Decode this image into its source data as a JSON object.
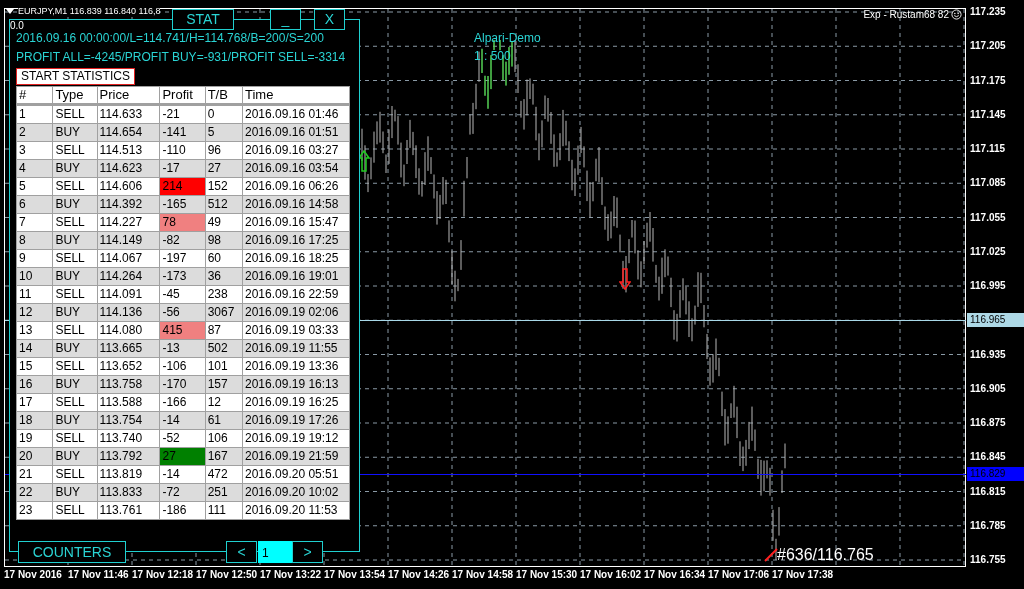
{
  "chart": {
    "header": "EURJPY,M1  116.839 116.840 116,8",
    "broker": "Alpari-Demo",
    "leverage": "1 : 500",
    "expert": "Exp - Rustam68 82",
    "trade_label": "#636/116.765",
    "bid_line": "116.965",
    "ask_line": "116.829",
    "price_labels": [
      "117.235",
      "117.205",
      "117.175",
      "117.145",
      "117.115",
      "117.085",
      "117.055",
      "117.025",
      "116.995",
      "116.935",
      "116.905",
      "116.875",
      "116.845",
      "116.815",
      "116.785",
      "116.755"
    ],
    "time_labels": [
      "17 Nov 2016",
      "17 Nov 11:46",
      "17 Nov 12:18",
      "17 Nov 12:50",
      "17 Nov 13:22",
      "17 Nov 13:54",
      "17 Nov 14:26",
      "17 Nov 14:58",
      "17 Nov 15:30",
      "17 Nov 16:02",
      "17 Nov 16:34",
      "17 Nov 17:06",
      "17 Nov 17:38"
    ]
  },
  "panel": {
    "title": "STAT",
    "minimize": "_",
    "close": "X",
    "corner_value": "0.0",
    "info_line": "2016.09.16 00:00:00/L=114.741/H=114.768/B=200/S=200",
    "profit_line": "PROFIT ALL=-4245/PROFIT BUY=-931/PROFIT SELL=-3314",
    "start_button": "START STATISTICS",
    "table": {
      "columns": [
        "#",
        "Type",
        "Price",
        "Profit",
        "T/B",
        "Time"
      ],
      "rows": [
        {
          "cells": [
            "1",
            "SELL",
            "114.633",
            "-21",
            "0",
            "2016.09.16 01:46"
          ]
        },
        {
          "cells": [
            "2",
            "BUY",
            "114.654",
            "-141",
            "5",
            "2016.09.16 01:51"
          ]
        },
        {
          "cells": [
            "3",
            "SELL",
            "114.513",
            "-110",
            "96",
            "2016.09.16 03:27"
          ]
        },
        {
          "cells": [
            "4",
            "BUY",
            "114.623",
            "-17",
            "27",
            "2016.09.16 03:54"
          ]
        },
        {
          "cells": [
            "5",
            "SELL",
            "114.606",
            "214",
            "152",
            "2016.09.16 06:26"
          ],
          "color": "#ff0000"
        },
        {
          "cells": [
            "6",
            "BUY",
            "114.392",
            "-165",
            "512",
            "2016.09.16 14:58"
          ]
        },
        {
          "cells": [
            "7",
            "SELL",
            "114.227",
            "78",
            "49",
            "2016.09.16 15:47"
          ],
          "color": "#f08080"
        },
        {
          "cells": [
            "8",
            "BUY",
            "114.149",
            "-82",
            "98",
            "2016.09.16 17:25"
          ]
        },
        {
          "cells": [
            "9",
            "SELL",
            "114.067",
            "-197",
            "60",
            "2016.09.16 18:25"
          ]
        },
        {
          "cells": [
            "10",
            "BUY",
            "114.264",
            "-173",
            "36",
            "2016.09.16 19:01"
          ]
        },
        {
          "cells": [
            "11",
            "SELL",
            "114.091",
            "-45",
            "238",
            "2016.09.16 22:59"
          ]
        },
        {
          "cells": [
            "12",
            "BUY",
            "114.136",
            "-56",
            "3067",
            "2016.09.19 02:06"
          ]
        },
        {
          "cells": [
            "13",
            "SELL",
            "114.080",
            "415",
            "87",
            "2016.09.19 03:33"
          ],
          "color": "#f08080"
        },
        {
          "cells": [
            "14",
            "BUY",
            "113.665",
            "-13",
            "502",
            "2016.09.19 11:55"
          ]
        },
        {
          "cells": [
            "15",
            "SELL",
            "113.652",
            "-106",
            "101",
            "2016.09.19 13:36"
          ]
        },
        {
          "cells": [
            "16",
            "BUY",
            "113.758",
            "-170",
            "157",
            "2016.09.19 16:13"
          ]
        },
        {
          "cells": [
            "17",
            "SELL",
            "113.588",
            "-166",
            "12",
            "2016.09.19 16:25"
          ]
        },
        {
          "cells": [
            "18",
            "BUY",
            "113.754",
            "-14",
            "61",
            "2016.09.19 17:26"
          ]
        },
        {
          "cells": [
            "19",
            "SELL",
            "113.740",
            "-52",
            "106",
            "2016.09.19 19:12"
          ]
        },
        {
          "cells": [
            "20",
            "BUY",
            "113.792",
            "27",
            "167",
            "2016.09.19 21:59"
          ],
          "color": "#008000"
        },
        {
          "cells": [
            "21",
            "SELL",
            "113.819",
            "-14",
            "472",
            "2016.09.20 05:51"
          ]
        },
        {
          "cells": [
            "22",
            "BUY",
            "113.833",
            "-72",
            "251",
            "2016.09.20 10:02"
          ]
        },
        {
          "cells": [
            "23",
            "SELL",
            "113.761",
            "-186",
            "111",
            "2016.09.20 11:53"
          ]
        }
      ]
    },
    "counters_button": "COUNTERS",
    "prev": "<",
    "page": "1",
    "next": ">"
  }
}
